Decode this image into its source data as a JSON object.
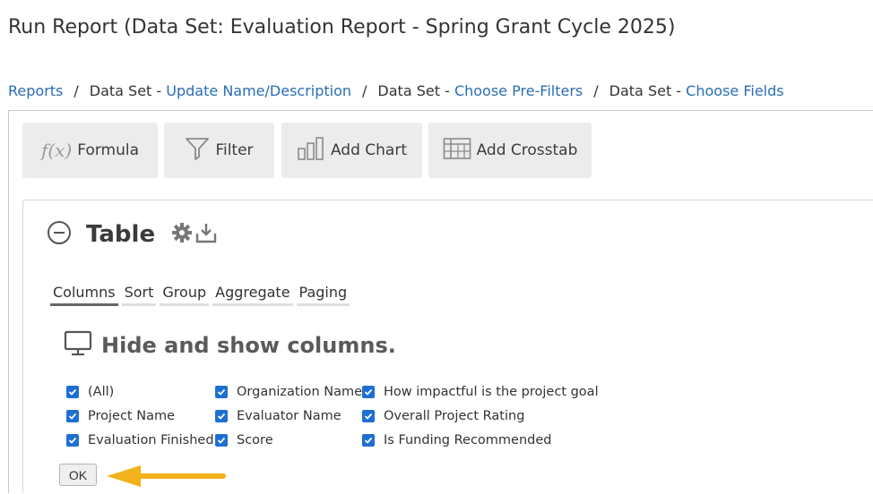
{
  "page": {
    "title": "Run Report (Data Set: Evaluation Report - Spring Grant Cycle 2025)"
  },
  "breadcrumb": {
    "reports": "Reports",
    "sep": "/",
    "data_set_prefix": "Data Set - ",
    "update_name": "Update Name/Description",
    "choose_prefilters": "Choose Pre-Filters",
    "choose_fields": "Choose Fields"
  },
  "toolbar": {
    "formula_icon_text": "f(x)",
    "formula": "Formula",
    "filter": "Filter",
    "add_chart": "Add Chart",
    "add_crosstab": "Add Crosstab"
  },
  "table_panel": {
    "title": "Table",
    "tabs": [
      "Columns",
      "Sort",
      "Group",
      "Aggregate",
      "Paging"
    ],
    "active_tab": "Columns",
    "section_title": "Hide and show columns.",
    "columns": [
      [
        {
          "label": "(All)",
          "checked": true
        },
        {
          "label": "Project Name",
          "checked": true
        },
        {
          "label": "Evaluation Finished",
          "checked": true
        }
      ],
      [
        {
          "label": "Organization Name",
          "checked": true
        },
        {
          "label": "Evaluator Name",
          "checked": true
        },
        {
          "label": "Score",
          "checked": true
        }
      ],
      [
        {
          "label": "How impactful is the project goal",
          "checked": true
        },
        {
          "label": "Overall Project Rating",
          "checked": true
        },
        {
          "label": "Is Funding Recommended",
          "checked": true
        }
      ]
    ],
    "ok": "OK"
  },
  "colors": {
    "link": "#2a6db5",
    "checkbox": "#1f6fd1",
    "arrow": "#f2b21b",
    "toolbar_bg": "#ececec"
  }
}
